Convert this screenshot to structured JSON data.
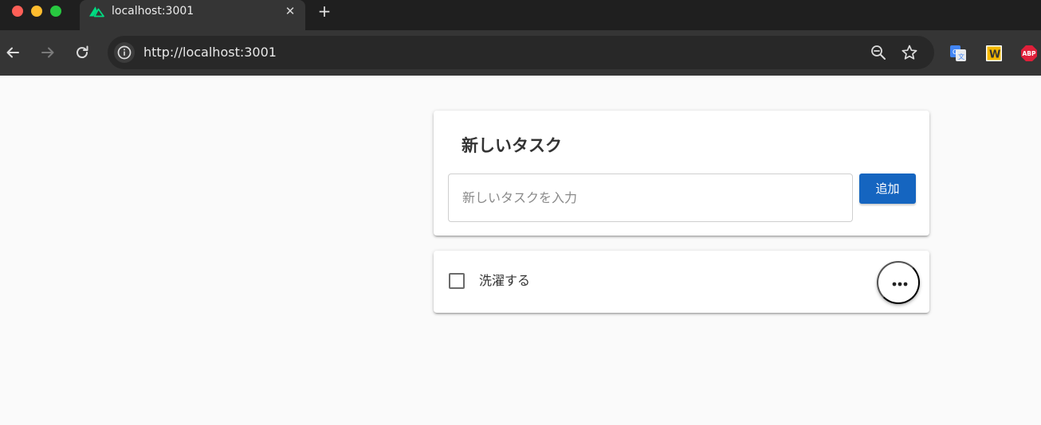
{
  "browser": {
    "tab_title": "localhost:3001",
    "tab_close_glyph": "✕",
    "new_tab_glyph": "+",
    "url": "http://localhost:3001",
    "extensions": {
      "w_label": "W",
      "abp_label": "ABP"
    },
    "icons": [
      "nuxt-favicon-icon",
      "back-arrow-icon",
      "forward-arrow-icon",
      "reload-icon",
      "site-info-icon",
      "zoom-icon",
      "bookmark-star-icon",
      "google-translate-icon",
      "w-extension-icon",
      "adblock-plus-icon",
      "more-horizontal-icon"
    ]
  },
  "new_task": {
    "title": "新しいタスク",
    "input_placeholder": "新しいタスクを入力",
    "input_value": "",
    "add_label": "追加"
  },
  "tasks": [
    {
      "text": "洗濯する",
      "done": false
    }
  ],
  "colors": {
    "primary": "#1565c0",
    "nuxt_green": "#00dc82",
    "abp_red": "#e0203a",
    "w_yellow": "#f5b800"
  }
}
